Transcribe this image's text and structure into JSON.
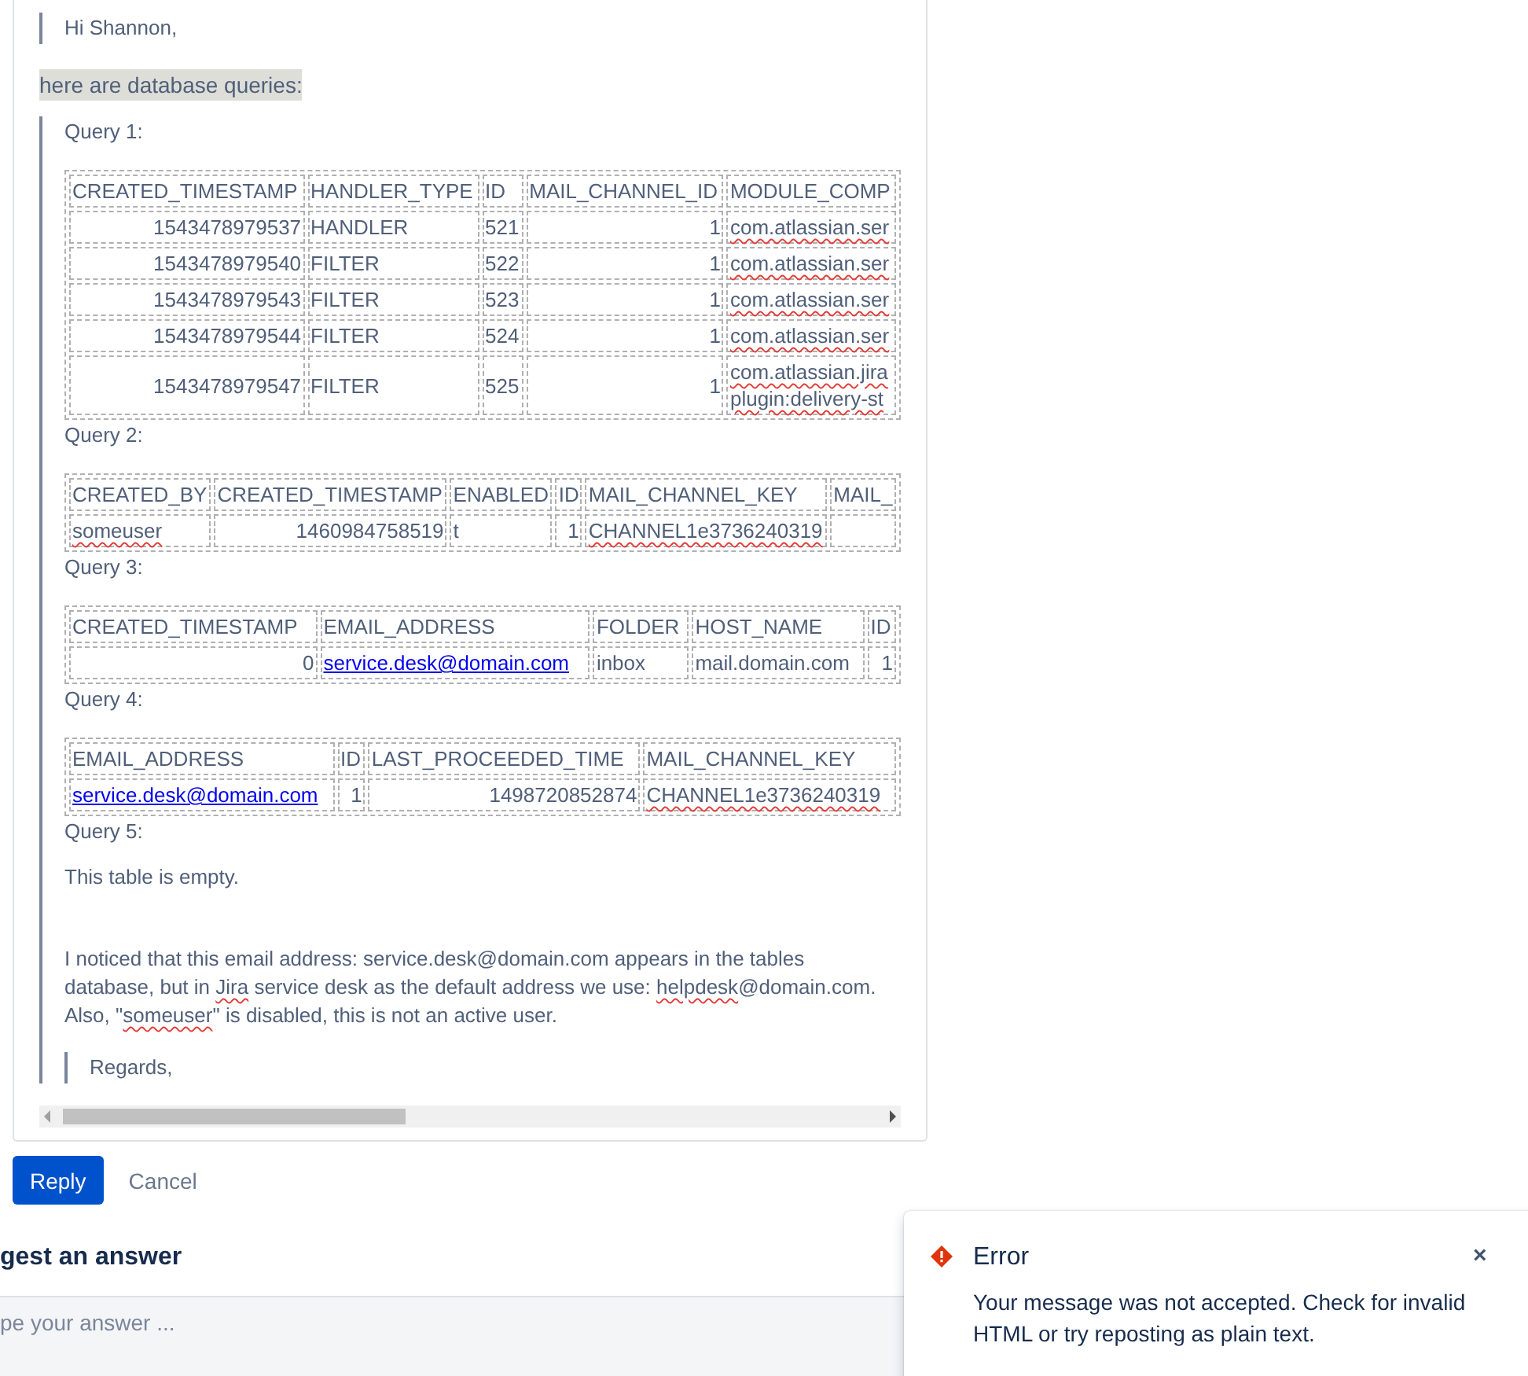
{
  "editor": {
    "blocks": [
      {
        "kind": "quote",
        "items": [
          {
            "kind": "label",
            "text": "Hi Shannon,"
          }
        ]
      },
      {
        "kind": "highlight",
        "text": "here are database queries:"
      },
      {
        "kind": "quote",
        "items": [
          {
            "kind": "label",
            "text": "Query 1:"
          },
          {
            "kind": "table",
            "columns": [
              "CREATED_TIMESTAMP",
              "HANDLER_TYPE",
              "ID",
              "MAIL_CHANNEL_ID",
              "MODULE_COMP"
            ],
            "rows": [
              [
                {
                  "text": "1543478979537",
                  "kind": "number"
                },
                {
                  "text": "HANDLER",
                  "kind": "text"
                },
                {
                  "text": "521",
                  "kind": "text"
                },
                {
                  "text": "1",
                  "kind": "number"
                },
                {
                  "text": "com.atlassian.ser",
                  "kind": "misspelled"
                }
              ],
              [
                {
                  "text": "1543478979540",
                  "kind": "number"
                },
                {
                  "text": "FILTER",
                  "kind": "text"
                },
                {
                  "text": "522",
                  "kind": "text"
                },
                {
                  "text": "1",
                  "kind": "number"
                },
                {
                  "text": "com.atlassian.ser",
                  "kind": "misspelled"
                }
              ],
              [
                {
                  "text": "1543478979543",
                  "kind": "number"
                },
                {
                  "text": "FILTER",
                  "kind": "text"
                },
                {
                  "text": "523",
                  "kind": "text"
                },
                {
                  "text": "1",
                  "kind": "number"
                },
                {
                  "text": "com.atlassian.ser",
                  "kind": "misspelled"
                }
              ],
              [
                {
                  "text": "1543478979544",
                  "kind": "number"
                },
                {
                  "text": "FILTER",
                  "kind": "text"
                },
                {
                  "text": "524",
                  "kind": "text"
                },
                {
                  "text": "1",
                  "kind": "number"
                },
                {
                  "text": "com.atlassian.ser",
                  "kind": "misspelled"
                }
              ],
              [
                {
                  "text": "1543478979547",
                  "kind": "number"
                },
                {
                  "text": "FILTER",
                  "kind": "text"
                },
                {
                  "text": "525",
                  "kind": "text"
                },
                {
                  "text": "1",
                  "kind": "number"
                },
                {
                  "text": "com.atlassian.jira\nplugin:delivery-st",
                  "kind": "misspelled"
                }
              ]
            ]
          },
          {
            "kind": "label",
            "text": "Query 2:"
          },
          {
            "kind": "table",
            "columns": [
              "CREATED_BY",
              "CREATED_TIMESTAMP",
              "ENABLED",
              "ID",
              "MAIL_CHANNEL_KEY",
              "MAIL_"
            ],
            "rows": [
              [
                {
                  "text": "someuser",
                  "kind": "misspelled"
                },
                {
                  "text": "1460984758519",
                  "kind": "number"
                },
                {
                  "text": "t",
                  "kind": "text"
                },
                {
                  "text": "1",
                  "kind": "number"
                },
                {
                  "text": "CHANNEL1e3736240319",
                  "kind": "misspelled"
                },
                {
                  "text": "",
                  "kind": "text"
                }
              ]
            ]
          },
          {
            "kind": "label",
            "text": "Query 3:"
          }
        ]
      },
      {
        "kind": "quote",
        "items": [
          {
            "kind": "table",
            "columns": [
              "CREATED_TIMESTAMP",
              "EMAIL_ADDRESS",
              "FOLDER",
              "HOST_NAME",
              "ID"
            ],
            "rows": [
              [
                {
                  "text": "0",
                  "kind": "number"
                },
                {
                  "text": "service.desk@domain.com",
                  "kind": "link"
                },
                {
                  "text": "inbox",
                  "kind": "text"
                },
                {
                  "text": "mail.domain.com",
                  "kind": "text"
                },
                {
                  "text": "1",
                  "kind": "number"
                }
              ]
            ]
          },
          {
            "kind": "label",
            "text": "Query 4:"
          }
        ]
      },
      {
        "kind": "quote",
        "items": [
          {
            "kind": "table",
            "columns": [
              "EMAIL_ADDRESS",
              "ID",
              "LAST_PROCEEDED_TIME",
              "MAIL_CHANNEL_KEY"
            ],
            "rows": [
              [
                {
                  "text": "service.desk@domain.com",
                  "kind": "link"
                },
                {
                  "text": "1",
                  "kind": "number"
                },
                {
                  "text": "1498720852874",
                  "kind": "number"
                },
                {
                  "text": "CHANNEL1e3736240319",
                  "kind": "misspelled"
                }
              ]
            ]
          },
          {
            "kind": "label",
            "text": "Query 5:"
          },
          {
            "kind": "paragraph",
            "segments": [
              {
                "text": "This table is empty.",
                "kind": "text"
              }
            ]
          },
          {
            "kind": "paragraph",
            "segments": [
              {
                "text": "I noticed that this email address: service.desk@domain.com appears in the tables database, but  in ",
                "kind": "text"
              },
              {
                "text": "Jira",
                "kind": "misspelled"
              },
              {
                "text": " service desk as the default address we use: ",
                "kind": "text"
              },
              {
                "text": "helpdesk",
                "kind": "misspelled"
              },
              {
                "text": "@domain.com. Also, \"",
                "kind": "text"
              },
              {
                "text": "someuser",
                "kind": "misspelled"
              },
              {
                "text": "\" is disabled, this is not an active user.",
                "kind": "text"
              }
            ]
          },
          {
            "kind": "quote",
            "items": [
              {
                "kind": "label",
                "text": "Regards,"
              }
            ]
          }
        ]
      }
    ]
  },
  "actions": {
    "primary": "Reply",
    "secondary": "Cancel"
  },
  "answer": {
    "heading": "gest an answer",
    "placeholder": "pe your answer ..."
  },
  "toast": {
    "title": "Error",
    "message": "Your message was not accepted. Check for invalid HTML or try reposting as plain text.",
    "close": "×"
  }
}
